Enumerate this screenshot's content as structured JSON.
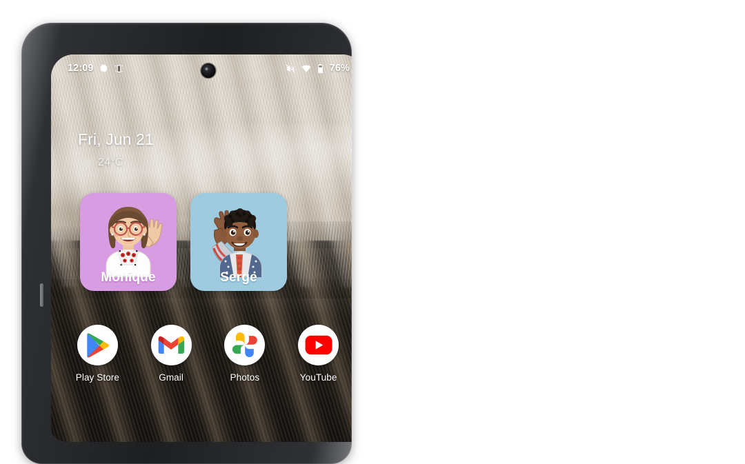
{
  "device": {
    "name": "android-phone",
    "frame_color": "#1d1f21",
    "side_button": "power-button"
  },
  "status_bar": {
    "time": "12:09",
    "left_icons": [
      "settings-gear-icon",
      "screenshot-icon"
    ],
    "right_icons": [
      "mute-icon",
      "wifi-icon",
      "battery-icon"
    ],
    "battery_percent": "76%",
    "camera": "front-camera-punch-hole"
  },
  "home_screen": {
    "wallpaper": "feather-texture-wallpaper",
    "date_widget": {
      "date": "Fri, Jun 21",
      "weather_icon": "cloud-icon",
      "temperature": "24°C"
    },
    "contact_widgets": [
      {
        "name": "Monique",
        "bg_color": "#d89ce2",
        "avatar": "waving-woman-memoji"
      },
      {
        "name": "Serge",
        "bg_color": "#9ecbe0",
        "avatar": "waving-boy-memoji"
      }
    ],
    "dock": [
      {
        "label": "Play Store",
        "icon": "play-store-icon"
      },
      {
        "label": "Gmail",
        "icon": "gmail-icon"
      },
      {
        "label": "Photos",
        "icon": "google-photos-icon"
      },
      {
        "label": "YouTube",
        "icon": "youtube-icon"
      }
    ]
  },
  "colors": {
    "text_on_wallpaper": "#ffffff",
    "gmail_red": "#ea4335",
    "gmail_blue": "#4285f4",
    "gmail_green": "#34a853",
    "gmail_yellow": "#fbbc04",
    "youtube_red": "#ff0000"
  }
}
